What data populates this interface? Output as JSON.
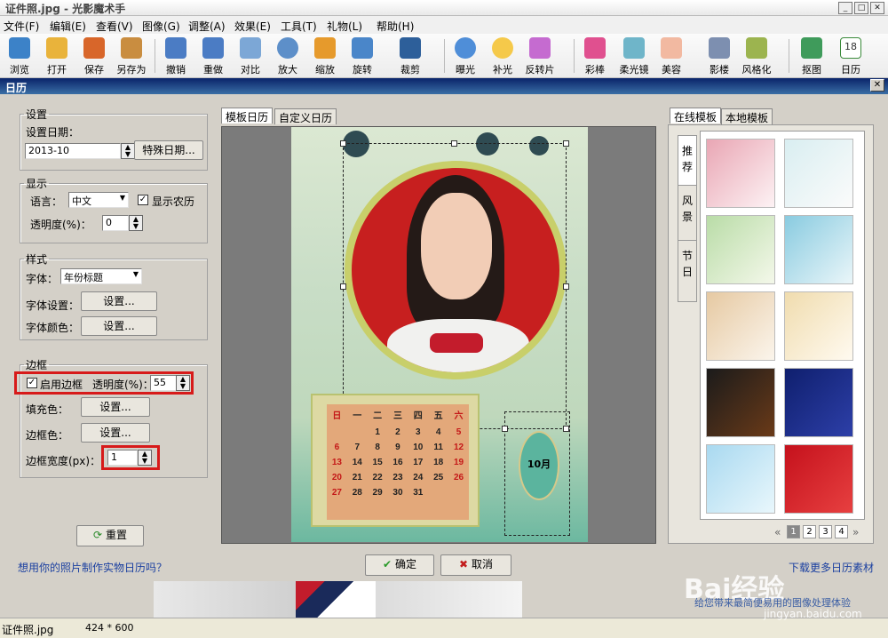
{
  "window": {
    "title": "证件照.jpg - 光影魔术手",
    "min": "_",
    "max": "□",
    "close": "✕"
  },
  "menu": [
    "文件(F)",
    "编辑(E)",
    "查看(V)",
    "图像(G)",
    "调整(A)",
    "效果(E)",
    "工具(T)",
    "礼物(L)",
    "帮助(H)"
  ],
  "toolbar": [
    "浏览",
    "打开",
    "保存",
    "另存为",
    "撤销",
    "重做",
    "对比",
    "放大",
    "缩放",
    "旋转",
    "裁剪",
    "曝光",
    "补光",
    "反转片",
    "彩棒",
    "柔光镜",
    "美容",
    "影楼",
    "风格化",
    "抠图",
    "日历"
  ],
  "calendar_icon_day": "18",
  "dialog": {
    "title": "日历",
    "close": "✕"
  },
  "settings": {
    "legend": "设置",
    "date_label": "设置日期：",
    "date_value": "2013-10",
    "special_btn": "特殊日期..."
  },
  "display": {
    "legend": "显示",
    "lang_label": "语言：",
    "lang_value": "中文",
    "lunar_label": "显示农历",
    "lunar_checked": "✓",
    "opacity_label": "透明度(%)：",
    "opacity_value": "0"
  },
  "style": {
    "legend": "样式",
    "font_label": "字体：",
    "font_value": "年份标题",
    "font_set_label": "字体设置：",
    "font_set_btn": "设置...",
    "font_color_label": "字体颜色：",
    "font_color_btn": "设置..."
  },
  "border": {
    "legend": "边框",
    "enable_label": "启用边框",
    "enable_checked": "✓",
    "opacity_label": "透明度(%)：",
    "opacity_value": "55",
    "fill_label": "填充色：",
    "fill_btn": "设置...",
    "border_color_label": "边框色：",
    "border_color_btn": "设置...",
    "width_label": "边框宽度(px)：",
    "width_value": "1"
  },
  "reset_btn": "重置",
  "tabs": {
    "template": "模板日历",
    "custom": "自定义日历"
  },
  "right_tabs": {
    "online": "在线模板",
    "local": "本地模板"
  },
  "side_tabs": [
    "推荐",
    "风景",
    "节日"
  ],
  "calendar": {
    "month_badge": "10月",
    "weekdays": [
      "日",
      "一",
      "二",
      "三",
      "四",
      "五",
      "六"
    ],
    "weeks": [
      [
        "",
        "",
        "1",
        "2",
        "3",
        "4",
        "5"
      ],
      [
        "6",
        "7",
        "8",
        "9",
        "10",
        "11",
        "12"
      ],
      [
        "13",
        "14",
        "15",
        "16",
        "17",
        "18",
        "19"
      ],
      [
        "20",
        "21",
        "22",
        "23",
        "24",
        "25",
        "26"
      ],
      [
        "27",
        "28",
        "29",
        "30",
        "31",
        "",
        ""
      ]
    ]
  },
  "pagination": {
    "prev": "«",
    "pages": [
      "1",
      "2",
      "3",
      "4"
    ],
    "next": "»"
  },
  "bottom": {
    "link": "想用你的照片制作实物日历吗？",
    "ok": "确定",
    "cancel": "取消",
    "download": "下载更多日历素材"
  },
  "status": {
    "file": "证件照.jpg",
    "size": "424 * 600"
  },
  "watermark": {
    "brand": "Bai经验",
    "slogan": "给您带来最简便易用的图像处理体验",
    "url": "jingyan.baidu.com"
  },
  "colors": {
    "accent_red": "#d71a1a",
    "title_blue": "#0a246a"
  }
}
